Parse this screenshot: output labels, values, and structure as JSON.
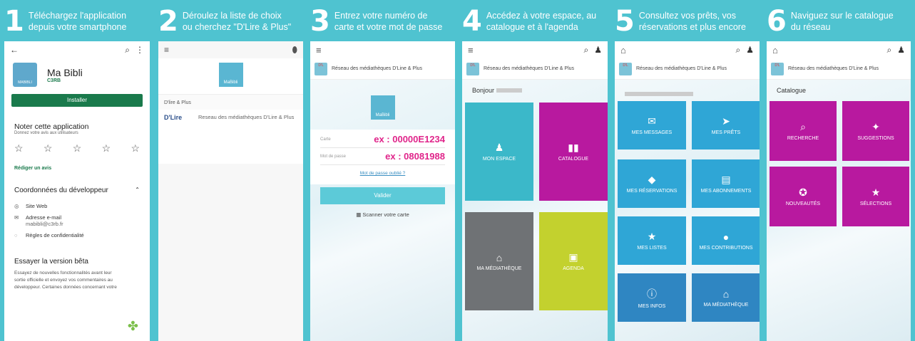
{
  "steps": [
    {
      "num": "1",
      "line1": "Téléchargez l'application",
      "line2": "depuis votre smartphone"
    },
    {
      "num": "2",
      "line1": "Déroulez la liste de choix",
      "line2": "ou cherchez \"D'Lire & Plus\""
    },
    {
      "num": "3",
      "line1": "Entrez votre numéro de",
      "line2": "carte et votre mot de passe"
    },
    {
      "num": "4",
      "line1": "Accédez à votre espace, au",
      "line2": "catalogue et à l'agenda"
    },
    {
      "num": "5",
      "line1": "Consultez vos prêts, vos",
      "line2": "réservations et plus encore"
    },
    {
      "num": "6",
      "line1": "Naviguez sur le catalogue",
      "line2": "du réseau"
    }
  ],
  "store": {
    "app_name": "Ma Bibli",
    "developer": "C3RB",
    "logo_text": "MABIBLI",
    "install": "Installer",
    "rate_title": "Noter cette application",
    "rate_sub": "Donnez votre avis aux utilisateurs",
    "write_review": "Rédiger un avis",
    "dev_contact": "Coordonnées du développeur",
    "website": "Site Web",
    "email_label": "Adresse e-mail",
    "email": "mabibli@c3rb.fr",
    "privacy": "Règles de confidentialité",
    "beta_title": "Essayer la version bêta",
    "beta_text": "Essayez de nouvelles fonctionnalités avant leur sortie officielle et envoyez vos commentaires au développeur. Certaines données concernant votre"
  },
  "picker": {
    "logo_text": "MaBibli",
    "section": "D'lire & Plus",
    "network_name": "Reseau des médiathèques D'Lire & Plus",
    "dlire_logo": "D'Lire"
  },
  "login": {
    "header": "Réseau des médiathèques D'Line & Plus",
    "logo_text": "MaBibli",
    "card_label": "Carte",
    "card_value": "ex : 00000E1234",
    "pass_label": "Mot de passe",
    "pass_value": "ex : 08081988",
    "forgot": "Mot de passe oublié ?",
    "submit": "Valider",
    "scan": "Scanner votre carte"
  },
  "home": {
    "header": "Réseau des médiathèques D'Line & Plus",
    "greeting": "Bonjour",
    "tiles": [
      "MON ESPACE",
      "CATALOGUE",
      "MA MÉDIATHÈQUE",
      "AGENDA"
    ]
  },
  "account": {
    "header": "Réseau des médiathèques D'Line & Plus",
    "tiles": [
      "MES MESSAGES",
      "MES PRÊTS",
      "MES RÉSERVATIONS",
      "MES ABONNEMENTS",
      "MES LISTES",
      "MES CONTRIBUTIONS",
      "MES INFOS",
      "MA MÉDIATHÈQUE"
    ]
  },
  "catalog": {
    "header": "Réseau des médiathèques D'Line & Plus",
    "title": "Catalogue",
    "tiles": [
      "RECHERCHE",
      "SUGGESTIONS",
      "NOUVEAUTÉS",
      "SÉLECTIONS"
    ]
  },
  "colors": {
    "teal": "#3bb8c9",
    "magenta": "#b8199f",
    "grey": "#6f7275",
    "lime": "#c3d12e",
    "blue": "#2fa6d6",
    "green": "#1a7a4c",
    "pink": "#e0248a"
  }
}
